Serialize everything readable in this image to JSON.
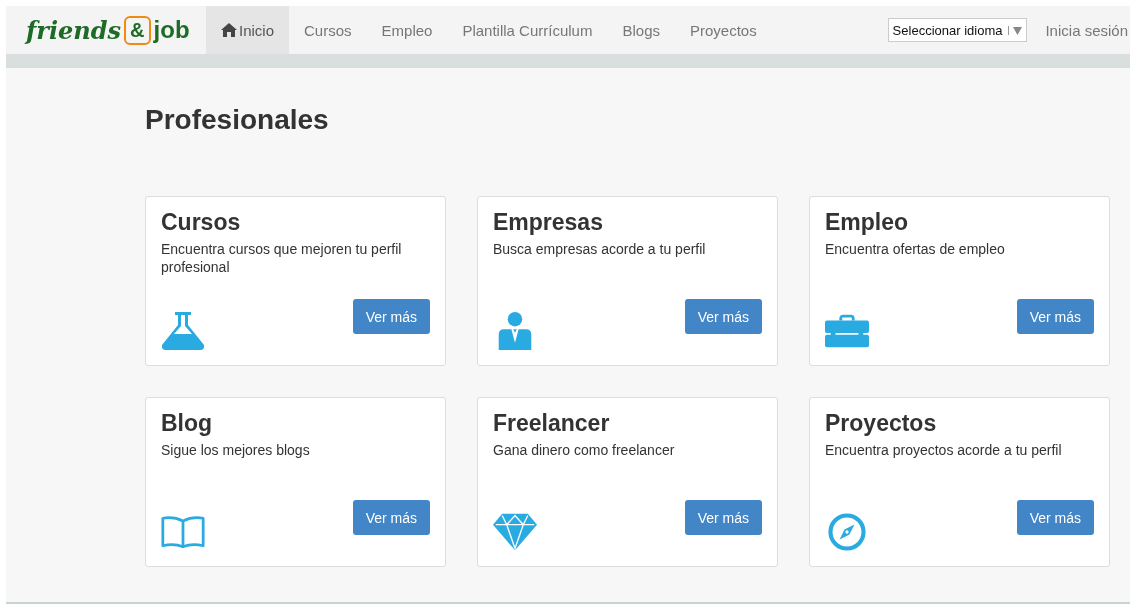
{
  "logo": {
    "word_1": "friends",
    "mark": "&",
    "word_2": "job"
  },
  "nav": [
    {
      "label": "Inicio",
      "selected": true,
      "home": true
    },
    {
      "label": "Cursos",
      "selected": false,
      "home": false
    },
    {
      "label": "Empleo",
      "selected": false,
      "home": false
    },
    {
      "label": "Plantilla Currículum",
      "selected": false,
      "home": false
    },
    {
      "label": "Blogs",
      "selected": false,
      "home": false
    },
    {
      "label": "Proyectos",
      "selected": false,
      "home": false
    }
  ],
  "language_select": {
    "value": "Seleccionar idioma"
  },
  "login": "Inicia sesión",
  "heading": "Profesionales",
  "cards": [
    {
      "title": "Cursos",
      "text": "Encuentra cursos que mejoren tu perfil profesional",
      "kind": "flask",
      "button": "Ver más"
    },
    {
      "title": "Empresas",
      "text": "Busca empresas acorde a tu perfil",
      "kind": "person",
      "button": "Ver más"
    },
    {
      "title": "Empleo",
      "text": "Encuentra ofertas de empleo",
      "kind": "briefcase",
      "button": "Ver más"
    },
    {
      "title": "Blog",
      "text": "Sigue los mejores blogs",
      "kind": "book",
      "button": "Ver más"
    },
    {
      "title": "Freelancer",
      "text": "Gana dinero como freelancer",
      "kind": "diamond",
      "button": "Ver más"
    },
    {
      "title": "Proyectos",
      "text": "Encuentra proyectos acorde a tu perfil",
      "kind": "compass",
      "button": "Ver más"
    }
  ]
}
